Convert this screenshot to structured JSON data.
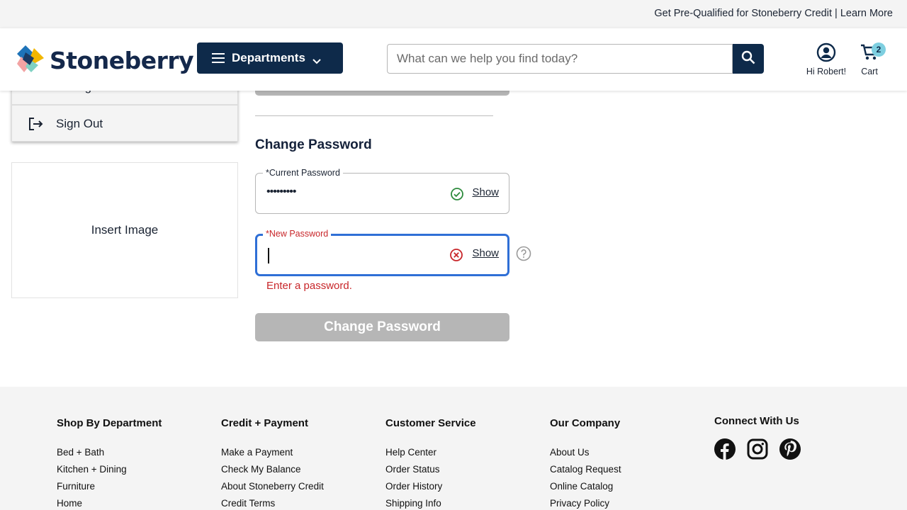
{
  "promo": {
    "text": "Get Pre-Qualified for Stoneberry Credit",
    "separator": "|",
    "link": "Learn More"
  },
  "header": {
    "logo_text": "Stoneberry",
    "departments_label": "Departments",
    "search_placeholder": "What can we help you find today?",
    "account_label": "Hi Robert!",
    "cart_label": "Cart",
    "cart_count": "2"
  },
  "sidebar": {
    "items": [
      {
        "label": "Change Password",
        "icon": "key-icon"
      },
      {
        "label": "Sign Out",
        "icon": "sign-out-icon"
      }
    ],
    "image_placeholder": "Insert Image"
  },
  "form": {
    "title": "Change Password",
    "current": {
      "label": "*Current Password",
      "value": "•••••••••",
      "status_icon": "check-circle-icon",
      "show_label": "Show"
    },
    "new": {
      "label": "*New Password",
      "value": "",
      "status_icon": "error-circle-icon",
      "show_label": "Show"
    },
    "error": "Enter a password.",
    "submit_label": "Change Password"
  },
  "colors": {
    "navy": "#0e2a4a",
    "error": "#c8262a",
    "focus": "#2f6fd6",
    "disabled": "#b6b6b6",
    "success": "#2e8b3d",
    "badge": "#7ecfe0"
  },
  "footer": {
    "columns": [
      {
        "heading": "Shop By Department",
        "links": [
          "Bed + Bath",
          "Kitchen + Dining",
          "Furniture",
          "Home"
        ]
      },
      {
        "heading": "Credit + Payment",
        "links": [
          "Make a Payment",
          "Check My Balance",
          "About Stoneberry Credit",
          "Credit Terms"
        ]
      },
      {
        "heading": "Customer Service",
        "links": [
          "Help Center",
          "Order Status",
          "Order History",
          "Shipping Info"
        ]
      },
      {
        "heading": "Our Company",
        "links": [
          "About Us",
          "Catalog Request",
          "Online Catalog",
          "Privacy Policy"
        ]
      }
    ],
    "social_heading": "Connect With Us",
    "social": [
      "facebook-icon",
      "instagram-icon",
      "pinterest-icon"
    ]
  }
}
